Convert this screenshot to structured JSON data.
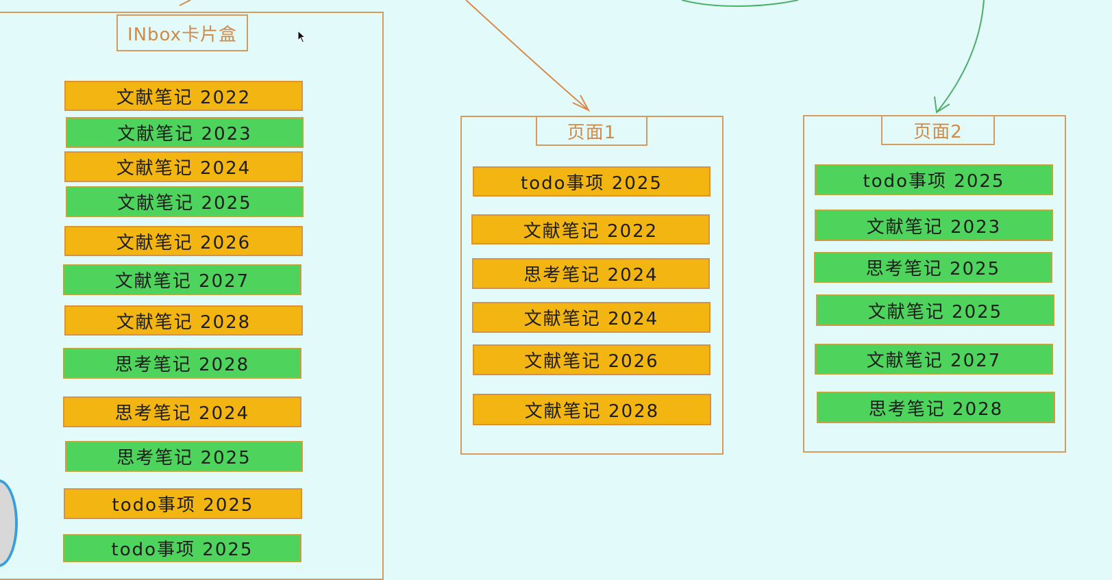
{
  "colors": {
    "background": "#e2fbfa",
    "border": "#d69a5c",
    "orange": "#f2b511",
    "green": "#4ed35c",
    "arrow_orange": "#d88a4a",
    "arrow_green": "#4fae6a"
  },
  "inbox": {
    "title": "INbox卡片盒",
    "cards": [
      {
        "label": "文献笔记 2022",
        "color": "orange"
      },
      {
        "label": "文献笔记 2023",
        "color": "green"
      },
      {
        "label": "文献笔记 2024",
        "color": "orange"
      },
      {
        "label": "文献笔记 2025",
        "color": "green"
      },
      {
        "label": "文献笔记 2026",
        "color": "orange"
      },
      {
        "label": "文献笔记 2027",
        "color": "green"
      },
      {
        "label": "文献笔记 2028",
        "color": "orange"
      },
      {
        "label": "思考笔记 2028",
        "color": "green"
      },
      {
        "label": "思考笔记 2024",
        "color": "orange"
      },
      {
        "label": "思考笔记 2025",
        "color": "green"
      },
      {
        "label": "todo事项 2025",
        "color": "orange"
      },
      {
        "label": "todo事项 2025",
        "color": "green"
      }
    ]
  },
  "page1": {
    "title": "页面1",
    "cards": [
      {
        "label": "todo事项 2025",
        "color": "orange"
      },
      {
        "label": "文献笔记 2022",
        "color": "orange"
      },
      {
        "label": "思考笔记 2024",
        "color": "orange"
      },
      {
        "label": "文献笔记 2024",
        "color": "orange"
      },
      {
        "label": "文献笔记 2026",
        "color": "orange"
      },
      {
        "label": "文献笔记 2028",
        "color": "orange"
      }
    ]
  },
  "page2": {
    "title": "页面2",
    "cards": [
      {
        "label": "todo事项 2025",
        "color": "green"
      },
      {
        "label": "文献笔记 2023",
        "color": "green"
      },
      {
        "label": "思考笔记 2025",
        "color": "green"
      },
      {
        "label": "文献笔记 2025",
        "color": "green"
      },
      {
        "label": "文献笔记 2027",
        "color": "green"
      },
      {
        "label": "思考笔记 2028",
        "color": "green"
      }
    ]
  },
  "icons": {
    "cursor": "mouse-pointer-icon"
  }
}
